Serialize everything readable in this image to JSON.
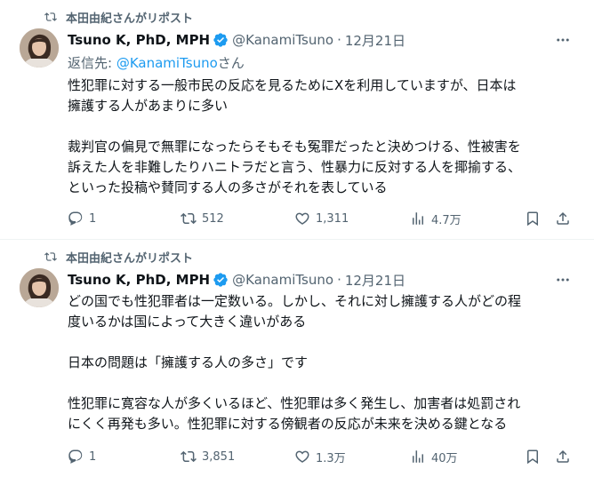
{
  "colors": {
    "accent": "#1d9bf0",
    "secondary_text": "#536471",
    "primary_text": "#0f1419",
    "divider": "#eff3f4"
  },
  "tweets": [
    {
      "repost_label": "本田由紀さんがリポスト",
      "author": {
        "display_name": "Tsuno K, PhD, MPH",
        "handle": "@KanamiTsuno",
        "verified": true
      },
      "separator": "·",
      "date": "12月21日",
      "reply_to": {
        "prefix": "返信先: ",
        "mention": "@KanamiTsuno",
        "suffix": "さん"
      },
      "text_lines": [
        "性犯罪に対する一般市民の反応を見るためにXを利用していますが、日本は",
        "擁護する人があまりに多い",
        "",
        "裁判官の偏見で無罪になったらそもそも冤罪だったと決めつける、性被害を",
        "訴えた人を非難したりハニトラだと言う、性暴力に反対する人を揶揄する、",
        "といった投稿や賛同する人の多さがそれを表している"
      ],
      "stats": {
        "replies": "1",
        "reposts": "512",
        "likes": "1,311",
        "views": "4.7万"
      }
    },
    {
      "repost_label": "本田由紀さんがリポスト",
      "author": {
        "display_name": "Tsuno K, PhD, MPH",
        "handle": "@KanamiTsuno",
        "verified": true
      },
      "separator": "·",
      "date": "12月21日",
      "text_lines": [
        "どの国でも性犯罪者は一定数いる。しかし、それに対し擁護する人がどの程",
        "度いるかは国によって大きく違いがある",
        "",
        "日本の問題は「擁護する人の多さ」です",
        "",
        "性犯罪に寛容な人が多くいるほど、性犯罪は多く発生し、加害者は処罰され",
        "にくく再発も多い。性犯罪に対する傍観者の反応が未来を決める鍵となる"
      ],
      "stats": {
        "replies": "1",
        "reposts": "3,851",
        "likes": "1.3万",
        "views": "40万"
      }
    }
  ],
  "icons": {
    "repost": "repost-icon",
    "verified": "verified-badge-icon",
    "more": "more-dots-icon",
    "reply": "reply-icon",
    "retweet": "retweet-icon",
    "like": "heart-icon",
    "views": "views-chart-icon",
    "bookmark": "bookmark-icon",
    "share": "share-icon"
  }
}
